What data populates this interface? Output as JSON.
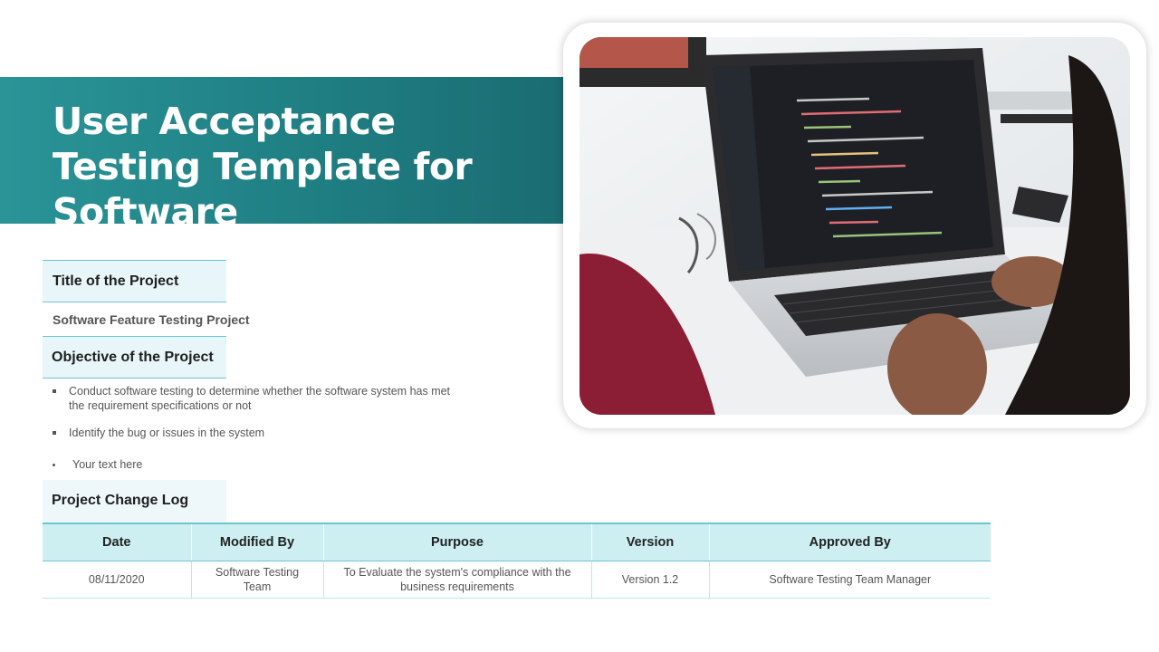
{
  "slide": {
    "title": "User Acceptance Testing Template for Software"
  },
  "project": {
    "title_label": "Title of the Project",
    "title_value": "Software Feature Testing Project",
    "objective_label": "Objective of the Project",
    "objectives": [
      "Conduct software testing to determine whether the software system has met the requirement  specifications or not",
      "Identify the bug or issues in the system",
      "Your text here"
    ]
  },
  "change_log": {
    "label": "Project Change Log",
    "columns": [
      "Date",
      "Modified By",
      "Purpose",
      "Version",
      "Approved By"
    ],
    "rows": [
      [
        "08/11/2020",
        "Software Testing Team",
        "To Evaluate the system's compliance with the business requirements",
        "Version 1.2",
        "Software Testing Team Manager"
      ]
    ]
  },
  "colors": {
    "accent": "#1f7f83",
    "header_fill": "#cdeff2",
    "label_fill": "#e8f6f9"
  },
  "icons": {
    "bullet": "square-bullet-icon"
  }
}
